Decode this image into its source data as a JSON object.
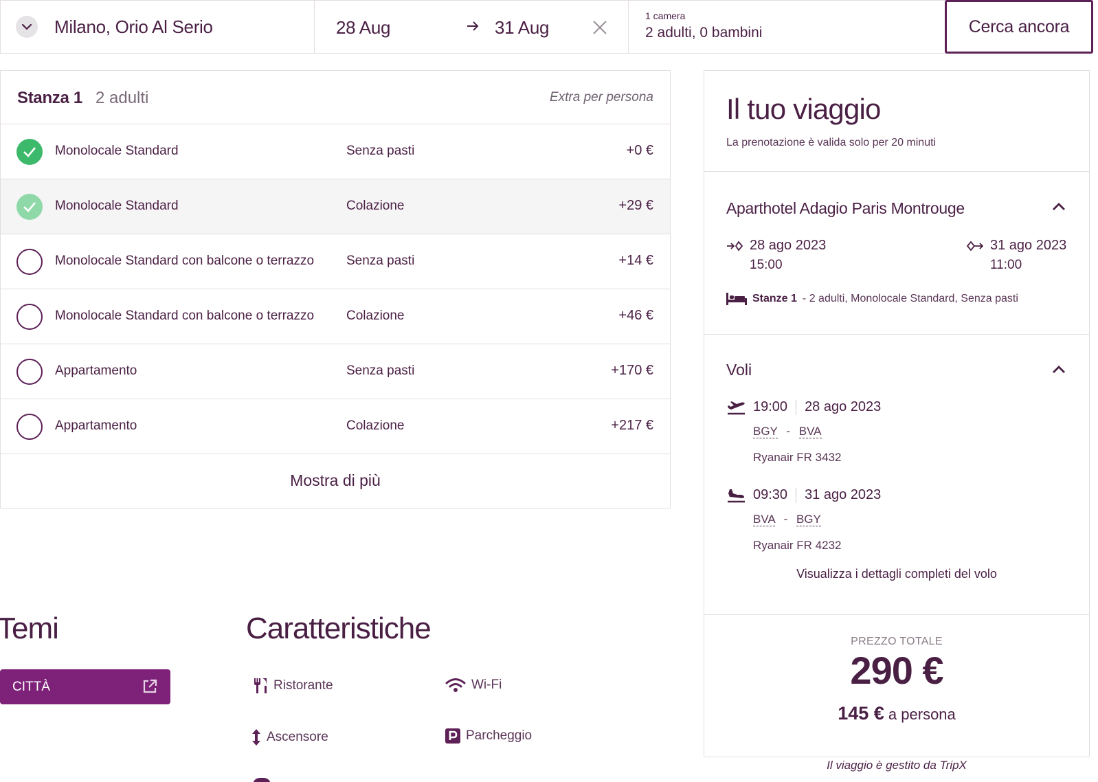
{
  "search": {
    "destination": "Milano, Orio Al Serio",
    "date_from": "28 Aug",
    "date_to": "31 Aug",
    "rooms": "1 camera",
    "guests": "2 adulti, 0 bambini",
    "button": "Cerca ancora"
  },
  "room": {
    "title": "Stanza 1",
    "adults": "2 adulti",
    "extra_label": "Extra per persona",
    "options": [
      {
        "name": "Monolocale Standard",
        "meal": "Senza pasti",
        "price": "+0 €",
        "selected": true
      },
      {
        "name": "Monolocale Standard",
        "meal": "Colazione",
        "price": "+29 €",
        "selected": false
      },
      {
        "name": "Monolocale Standard con balcone o terrazzo",
        "meal": "Senza pasti",
        "price": "+14 €",
        "selected": false
      },
      {
        "name": "Monolocale Standard con balcone o terrazzo",
        "meal": "Colazione",
        "price": "+46 €",
        "selected": false
      },
      {
        "name": "Appartamento",
        "meal": "Senza pasti",
        "price": "+170 €",
        "selected": false
      },
      {
        "name": "Appartamento",
        "meal": "Colazione",
        "price": "+217 €",
        "selected": false
      }
    ],
    "show_more": "Mostra di più"
  },
  "themes": {
    "heading": "Temi",
    "tag": "CITTÀ"
  },
  "features": {
    "heading": "Caratteristiche",
    "items": [
      {
        "label": "Ristorante",
        "icon": "restaurant-icon"
      },
      {
        "label": "Wi-Fi",
        "icon": "wifi-icon"
      },
      {
        "label": "Ascensore",
        "icon": "elevator-icon"
      },
      {
        "label": "Parcheggio",
        "icon": "parking-icon"
      }
    ]
  },
  "trip": {
    "title": "Il tuo viaggio",
    "validity": "La prenotazione è valida solo per 20 minuti",
    "hotel": {
      "name": "Aparthotel Adagio Paris Montrouge",
      "checkin_date": "28 ago 2023",
      "checkin_time": "15:00",
      "checkout_date": "31 ago 2023",
      "checkout_time": "11:00",
      "rooms_label": "Stanze 1",
      "rooms_detail": "- 2 adulti, Monolocale Standard, Senza pasti"
    },
    "flights": {
      "title": "Voli",
      "outbound": {
        "time": "19:00",
        "date": "28 ago 2023",
        "from": "BGY",
        "to": "BVA",
        "airline": "Ryanair FR 3432"
      },
      "return": {
        "time": "09:30",
        "date": "31 ago 2023",
        "from": "BVA",
        "to": "BGY",
        "airline": "Ryanair FR 4232"
      },
      "details_link": "Visualizza i dettagli completi del volo"
    },
    "total": {
      "label": "PREZZO TOTALE",
      "price": "290 €",
      "per_person_price": "145 €",
      "per_person_label": "a persona"
    },
    "managed_by": "Il viaggio è gestito da TripX"
  },
  "colors": {
    "brand": "#4a1f44",
    "accent": "#7e2279",
    "selected": "#3cb96a"
  }
}
